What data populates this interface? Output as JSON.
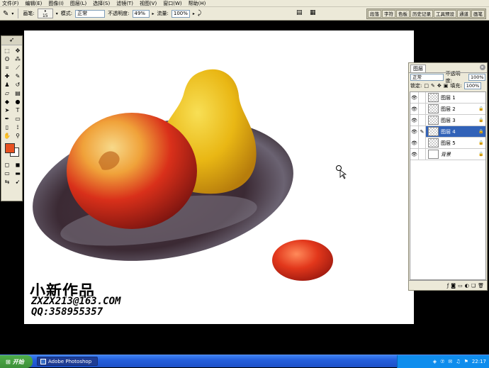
{
  "menu": [
    "文件(F)",
    "编辑(E)",
    "图像(I)",
    "图层(L)",
    "选择(S)",
    "滤镜(T)",
    "视图(V)",
    "窗口(W)",
    "帮助(H)"
  ],
  "options": {
    "brush_label": "画笔:",
    "brush_size": "15",
    "mode_label": "模式:",
    "mode_value": "正常",
    "opacity_label": "不透明度:",
    "opacity_value": "49%",
    "flow_label": "流量:",
    "flow_value": "100%"
  },
  "palette_tabs": [
    "段落",
    "字符",
    "色板",
    "历史记录",
    "工具预设",
    "通道",
    "画笔"
  ],
  "layers_panel": {
    "tab": "图层",
    "blend_mode": "正常",
    "opacity_label": "不透明度:",
    "opacity_value": "100%",
    "lock_label": "锁定:",
    "fill_label": "填充:",
    "fill_value": "100%",
    "layers": [
      {
        "name": "图层 1",
        "selected": false
      },
      {
        "name": "图层 2",
        "selected": false
      },
      {
        "name": "图层 3",
        "selected": false
      },
      {
        "name": "图层 4",
        "selected": true
      },
      {
        "name": "图层 5",
        "selected": false
      },
      {
        "name": "背景",
        "selected": false
      }
    ]
  },
  "watermark": {
    "line1": "小新作品",
    "line2": "ZXZX213@163.COM",
    "line3": "QQ:358955357"
  },
  "colors": {
    "foreground": "#e85120",
    "background": "#ffffff"
  },
  "taskbar": {
    "start": "开始",
    "app": "Adobe Photoshop",
    "time": "22:17"
  }
}
